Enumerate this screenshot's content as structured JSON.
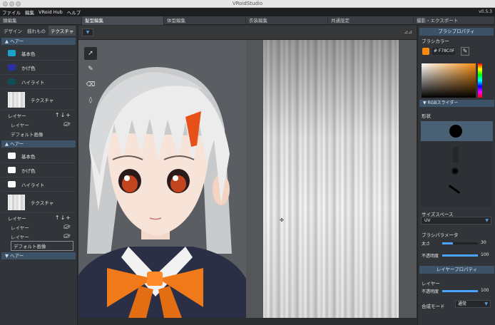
{
  "window": {
    "title": "VRoidStudio"
  },
  "menu": {
    "items": [
      "ファイル",
      "編集",
      "VRoid Hub",
      "ヘルプ"
    ],
    "version": "v0.5.3"
  },
  "tabs": [
    "頭編集",
    "髪型編集",
    "体型編集",
    "衣装編集",
    "共通設定",
    "撮影・エクスポート"
  ],
  "left_panel": {
    "subtabs": [
      "デザイン",
      "揺れもの",
      "テクスチャ"
    ],
    "sections": [
      {
        "title": "ヘアー",
        "colors": [
          {
            "label": "基本色",
            "color": "#1aa3c9"
          },
          {
            "label": "かげ色",
            "color": "#2a2fa6"
          },
          {
            "label": "ハイライト",
            "color": "#124d55"
          }
        ],
        "texture_label": "テクスチャ",
        "layer_label": "レイヤー",
        "layers": [
          "レイヤー",
          "デフォルト画像"
        ]
      },
      {
        "title": "ヘアー",
        "colors": [
          {
            "label": "基本色",
            "color": "#ffffff"
          },
          {
            "label": "かげ色",
            "color": "#ffffff"
          },
          {
            "label": "ハイライト",
            "color": "#ffffff"
          }
        ],
        "texture_label": "テクスチャ",
        "layer_label": "レイヤー",
        "layers": [
          "レイヤー",
          "レイヤー",
          "デフォルト画像"
        ]
      },
      {
        "title": "ヘアー"
      }
    ]
  },
  "right_panel": {
    "brush_props_title": "ブラシプロパティ",
    "brush_color_label": "ブラシカラー",
    "hex_value": "# F78C0F",
    "brush_color": "#f78c0f",
    "rgb_slider_label": "RGBスライダー",
    "shape_label": "形状",
    "size_space_label": "サイズスペース",
    "size_space_value": "UV",
    "brush_params_label": "ブラシパラメータ",
    "sliders": [
      {
        "name": "太さ",
        "value": "30",
        "fraction": 0.3
      },
      {
        "name": "不透明度",
        "value": "100",
        "fraction": 1.0
      }
    ],
    "layer_props_title": "レイヤープロパティ",
    "layer_label": "レイヤー",
    "layer_opacity": {
      "name": "不透明度",
      "value": "100",
      "fraction": 1.0
    },
    "blend_label": "合成モード",
    "blend_value": "通常"
  }
}
